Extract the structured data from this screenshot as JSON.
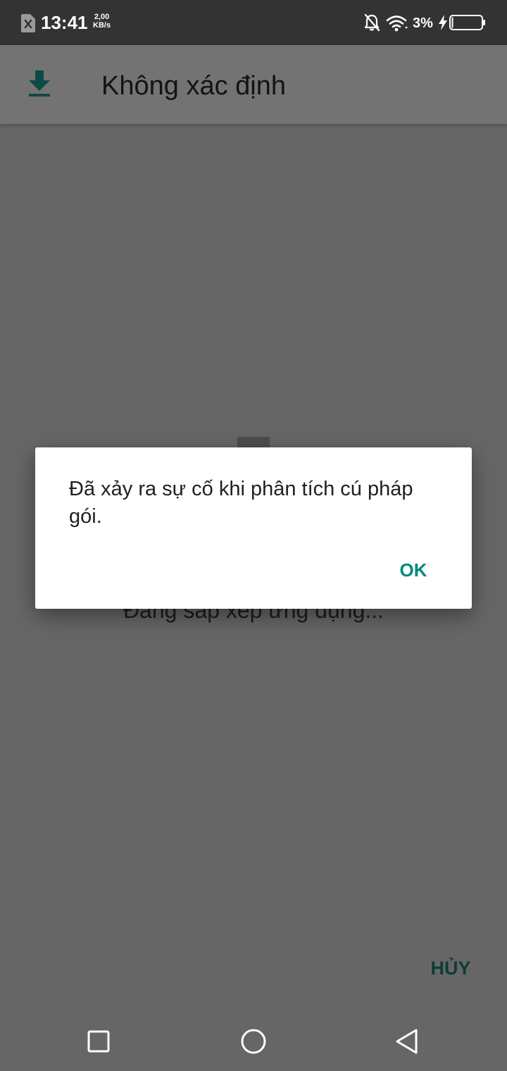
{
  "status_bar": {
    "time": "13:41",
    "net_speed_value": "2,00",
    "net_speed_unit": "KB/s",
    "battery_percent": "3%",
    "icons": [
      "sim-error-icon",
      "bell-off-icon",
      "wifi-icon",
      "charging-bolt-icon",
      "battery-icon"
    ]
  },
  "app_bar": {
    "title": "Không xác định",
    "icon": "download-icon",
    "accent_color": "#0e4a45"
  },
  "background": {
    "progress_text": "Đang sắp xếp ứng dụng...",
    "cancel_label": "HỦY"
  },
  "dialog": {
    "message": "Đã xảy ra sự cố khi phân tích cú pháp gói.",
    "ok_label": "OK",
    "button_color": "#00897b"
  },
  "nav_bar": {
    "icons": [
      "recents-icon",
      "home-icon",
      "back-icon"
    ]
  }
}
